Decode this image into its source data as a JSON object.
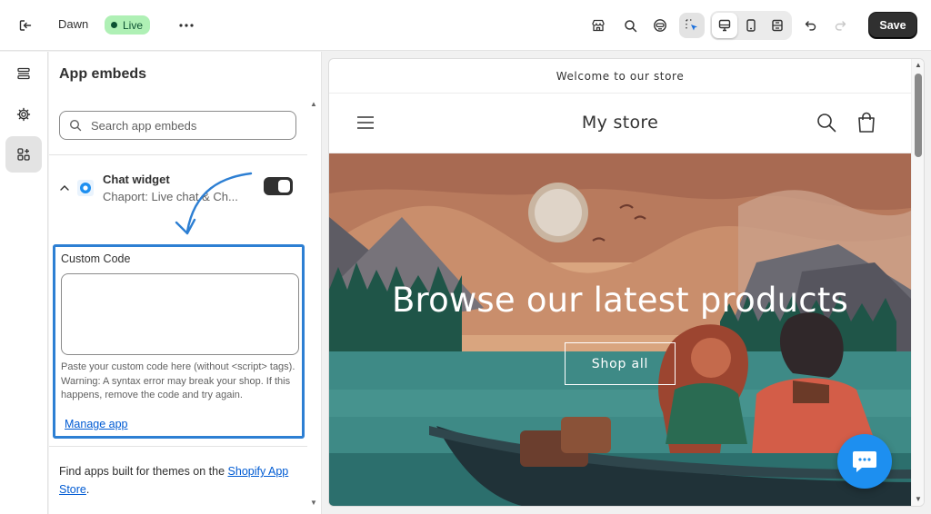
{
  "topbar": {
    "theme_name": "Dawn",
    "live_label": "Live",
    "save_label": "Save"
  },
  "panel": {
    "title": "App embeds",
    "search_placeholder": "Search app embeds",
    "app": {
      "name": "Chat widget",
      "description": "Chaport: Live chat & Ch..."
    },
    "custom_code": {
      "label": "Custom Code",
      "value": "",
      "help": "Paste your custom code here (without <script> tags). Warning: A syntax error may break your shop. If this happens, remove the code and try again.",
      "manage_link": "Manage app"
    },
    "footer": {
      "prefix": "Find apps built for themes on the ",
      "link": "Shopify App Store",
      "suffix": "."
    }
  },
  "preview": {
    "announcement": "Welcome to our store",
    "store_name": "My store",
    "hero_title": "Browse our latest products",
    "hero_button": "Shop all"
  },
  "colors": {
    "accent": "#005bd3",
    "highlight_border": "#2d7fd3",
    "live_badge_bg": "#aff0b5",
    "save_bg": "#303030",
    "chat_bubble": "#1d8ff0"
  }
}
